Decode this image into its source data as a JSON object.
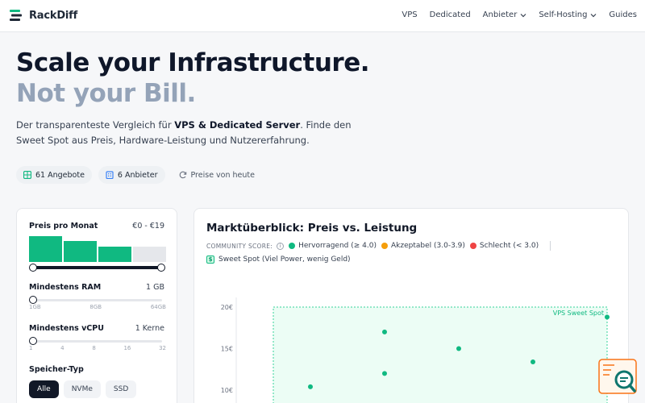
{
  "brand": {
    "name": "RackDiff"
  },
  "nav": {
    "links": [
      {
        "label": "VPS",
        "dropdown": false
      },
      {
        "label": "Dedicated",
        "dropdown": false
      },
      {
        "label": "Anbieter",
        "dropdown": true
      },
      {
        "label": "Self-Hosting",
        "dropdown": true
      },
      {
        "label": "Guides",
        "dropdown": false
      }
    ]
  },
  "hero": {
    "title_line1": "Scale your Infrastructure.",
    "title_line2": "Not your Bill.",
    "lead_prefix": "Der transparenteste Vergleich für ",
    "lead_bold": "VPS & Dedicated Server",
    "lead_suffix": ". Finde den Sweet Spot aus Preis, Hardware-Leistung und Nutzererfahrung."
  },
  "stats": {
    "offers": "61 Angebote",
    "providers": "6 Anbieter",
    "prices": "Preise von heute"
  },
  "filters": {
    "price": {
      "label": "Preis pro Monat",
      "value": "€0 - €19",
      "histogram": [
        1.0,
        0.82,
        0.6,
        0.6
      ],
      "active_bins": 3
    },
    "ram": {
      "label": "Mindestens RAM",
      "value": "1 GB",
      "ticks": [
        "1GB",
        "8GB",
        "64GB"
      ]
    },
    "vcpu": {
      "label": "Mindestens vCPU",
      "value": "1 Kerne",
      "ticks": [
        "1",
        "4",
        "8",
        "16",
        "32"
      ]
    },
    "storage": {
      "label": "Speicher-Typ",
      "options": [
        "Alle",
        "NVMe",
        "SSD"
      ],
      "selected": "Alle"
    }
  },
  "chart_card": {
    "title": "Marktüberblick: Preis vs. Leistung",
    "community_label": "COMMUNITY SCORE:",
    "legend": [
      {
        "label": "Hervorragend (≥ 4.0)",
        "color": "#10b981"
      },
      {
        "label": "Akzeptabel (3.0-3.9)",
        "color": "#f59e0b"
      },
      {
        "label": "Schlecht (< 3.0)",
        "color": "#ef4444"
      }
    ],
    "sweet_spot_label": "Sweet Spot (Viel Power, wenig Geld)",
    "sweet_spot_region_label": "VPS Sweet Spot"
  },
  "chart_data": {
    "type": "scatter",
    "title": "",
    "xlabel": "",
    "ylabel": "",
    "y_ticks": [
      "20€",
      "15€",
      "10€"
    ],
    "y_tick_values": [
      20,
      15,
      10
    ],
    "ylim": [
      5,
      21
    ],
    "xlim": [
      0,
      10
    ],
    "sweet_spot": {
      "x_min": 1,
      "x_max": 10,
      "y_min": 5,
      "y_max": 20
    },
    "points": [
      {
        "x": 4,
        "y": 17,
        "score": "Hervorragend"
      },
      {
        "x": 6,
        "y": 15,
        "score": "Hervorragend"
      },
      {
        "x": 8,
        "y": 13.4,
        "score": "Hervorragend"
      },
      {
        "x": 4,
        "y": 12,
        "score": "Hervorragend"
      },
      {
        "x": 2,
        "y": 10.4,
        "score": "Hervorragend"
      },
      {
        "x": 10,
        "y": 18.8,
        "score": "Hervorragend"
      }
    ],
    "colors": {
      "Hervorragend": "#10b981",
      "Akzeptabel": "#f59e0b",
      "Schlecht": "#ef4444"
    },
    "grid": false
  },
  "colors": {
    "accent": "#10b981",
    "text": "#0f172a",
    "muted": "#94a3b8"
  }
}
